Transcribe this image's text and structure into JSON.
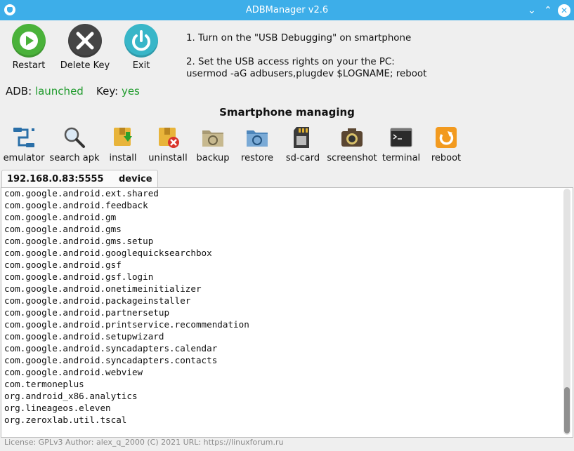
{
  "window": {
    "title": "ADBManager v2.6"
  },
  "top_buttons": [
    {
      "label": "Restart",
      "icon": "play-icon",
      "color": "#4ab23a"
    },
    {
      "label": "Delete Key",
      "icon": "close-icon",
      "color": "#454545"
    },
    {
      "label": "Exit",
      "icon": "power-icon",
      "color": "#38b6c8"
    }
  ],
  "instructions": {
    "step1": "1. Turn on the \"USB Debugging\" on smartphone",
    "step2_line1": "2. Set the USB access rights on your the PC:",
    "step2_line2": "usermod -aG adbusers,plugdev $LOGNAME; reboot"
  },
  "status": {
    "adb_label": "ADB:",
    "adb_value": "launched",
    "key_label": "Key:",
    "key_value": "yes",
    "value_color": "#1f9b2c"
  },
  "section_title": "Smartphone managing",
  "toolbar": [
    {
      "label": "emulator",
      "icon": "emulator-icon"
    },
    {
      "label": "search apk",
      "icon": "search-icon"
    },
    {
      "label": "install",
      "icon": "install-icon"
    },
    {
      "label": "uninstall",
      "icon": "uninstall-icon"
    },
    {
      "label": "backup",
      "icon": "backup-icon"
    },
    {
      "label": "restore",
      "icon": "restore-icon"
    },
    {
      "label": "sd-card",
      "icon": "sd-card-icon"
    },
    {
      "label": "screenshot",
      "icon": "camera-icon"
    },
    {
      "label": "terminal",
      "icon": "terminal-icon"
    },
    {
      "label": "reboot",
      "icon": "reboot-icon"
    }
  ],
  "device_tab": {
    "address": "192.168.0.83:5555",
    "state": "device"
  },
  "packages": [
    "com.google.android.ext.shared",
    "com.google.android.feedback",
    "com.google.android.gm",
    "com.google.android.gms",
    "com.google.android.gms.setup",
    "com.google.android.googlequicksearchbox",
    "com.google.android.gsf",
    "com.google.android.gsf.login",
    "com.google.android.onetimeinitializer",
    "com.google.android.packageinstaller",
    "com.google.android.partnersetup",
    "com.google.android.printservice.recommendation",
    "com.google.android.setupwizard",
    "com.google.android.syncadapters.calendar",
    "com.google.android.syncadapters.contacts",
    "com.google.android.webview",
    "com.termoneplus",
    "org.android_x86.analytics",
    "org.lineageos.eleven",
    "org.zeroxlab.util.tscal"
  ],
  "footer": "License: GPLv3   Author: alex_q_2000 (C) 2021   URL: https://linuxforum.ru",
  "theme": {
    "titlebar": "#3daee9",
    "background": "#efefef"
  }
}
